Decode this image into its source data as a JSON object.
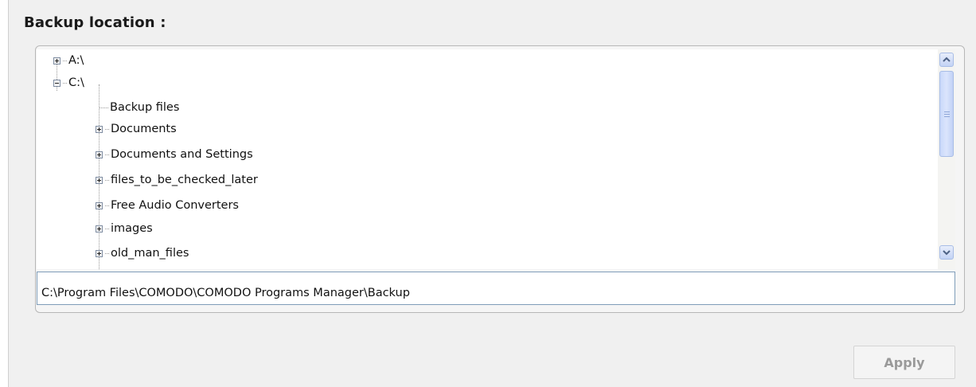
{
  "section": {
    "heading": "Backup location :"
  },
  "tree": {
    "drives": [
      {
        "label": "A:\\",
        "expanded": false
      },
      {
        "label": "C:\\",
        "expanded": true
      }
    ],
    "children": [
      {
        "label": "Backup files",
        "has_children": false
      },
      {
        "label": "Documents",
        "has_children": true
      },
      {
        "label": "Documents and Settings",
        "has_children": true
      },
      {
        "label": "files_to_be_checked_later",
        "has_children": true
      },
      {
        "label": "Free Audio Converters",
        "has_children": true
      },
      {
        "label": "images",
        "has_children": true
      },
      {
        "label": "old_man_files",
        "has_children": true
      }
    ]
  },
  "path_field": {
    "value": "C:\\Program Files\\COMODO\\COMODO Programs Manager\\Backup"
  },
  "actions": {
    "apply_label": "Apply",
    "apply_enabled": false
  },
  "icons": {
    "scroll_up": "scroll-up-arrow",
    "scroll_down": "scroll-down-arrow",
    "expand": "plus-box",
    "collapse": "minus-box"
  }
}
